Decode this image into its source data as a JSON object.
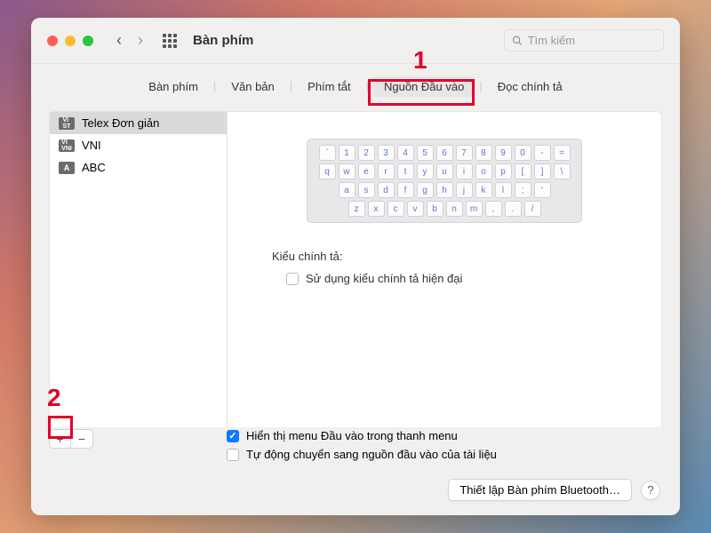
{
  "window": {
    "title": "Bàn phím"
  },
  "search": {
    "placeholder": "Tìm kiếm"
  },
  "tabs": [
    "Bàn phím",
    "Văn bản",
    "Phím tắt",
    "Nguồn Đầu vào",
    "Đọc chính tả"
  ],
  "active_tab_index": 3,
  "sources": [
    {
      "label": "Telex Đơn giản",
      "badge": "VI ST",
      "selected": true
    },
    {
      "label": "VNI",
      "badge": "VI VNI",
      "selected": false
    },
    {
      "label": "ABC",
      "badge": "A",
      "selected": false
    }
  ],
  "keyboard_rows": [
    [
      "`",
      "1",
      "2",
      "3",
      "4",
      "5",
      "6",
      "7",
      "8",
      "9",
      "0",
      "-",
      "="
    ],
    [
      "q",
      "w",
      "e",
      "r",
      "t",
      "y",
      "u",
      "i",
      "o",
      "p",
      "[",
      "]",
      "\\"
    ],
    [
      "a",
      "s",
      "d",
      "f",
      "g",
      "h",
      "j",
      "k",
      "l",
      ";",
      "'"
    ],
    [
      "z",
      "x",
      "c",
      "v",
      "b",
      "n",
      "m",
      ",",
      ".",
      "/"
    ]
  ],
  "detail": {
    "spelling_label": "Kiểu chính tả:",
    "modern_spelling": "Sử dụng kiểu chính tả hiện đại"
  },
  "bottom": {
    "show_menu": "Hiển thị menu Đầu vào trong thanh menu",
    "auto_switch": "Tự động chuyển sang nguồn đầu vào của tài liệu"
  },
  "footer": {
    "bluetooth": "Thiết lập Bàn phím Bluetooth…",
    "help": "?"
  },
  "annotations": {
    "label1": "1",
    "label2": "2"
  }
}
